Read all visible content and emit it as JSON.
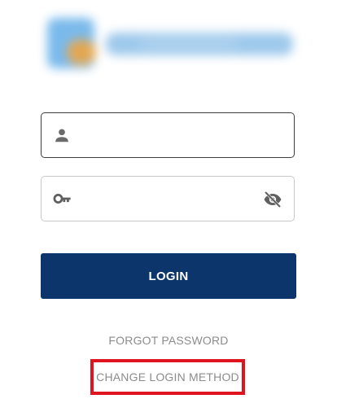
{
  "logo": {
    "icon": "blurred-logo-icon"
  },
  "username_field": {
    "value": "",
    "placeholder": "",
    "icon": "person-icon"
  },
  "password_field": {
    "value": "",
    "placeholder": "",
    "icon": "key-icon",
    "visibility_icon": "eye-off-icon"
  },
  "login_button": {
    "label": "LOGIN",
    "color": "#0b356b"
  },
  "links": {
    "forgot_password": "FORGOT PASSWORD",
    "change_login_method": "CHANGE LOGIN METHOD"
  },
  "highlight": {
    "color": "#e0141e"
  }
}
